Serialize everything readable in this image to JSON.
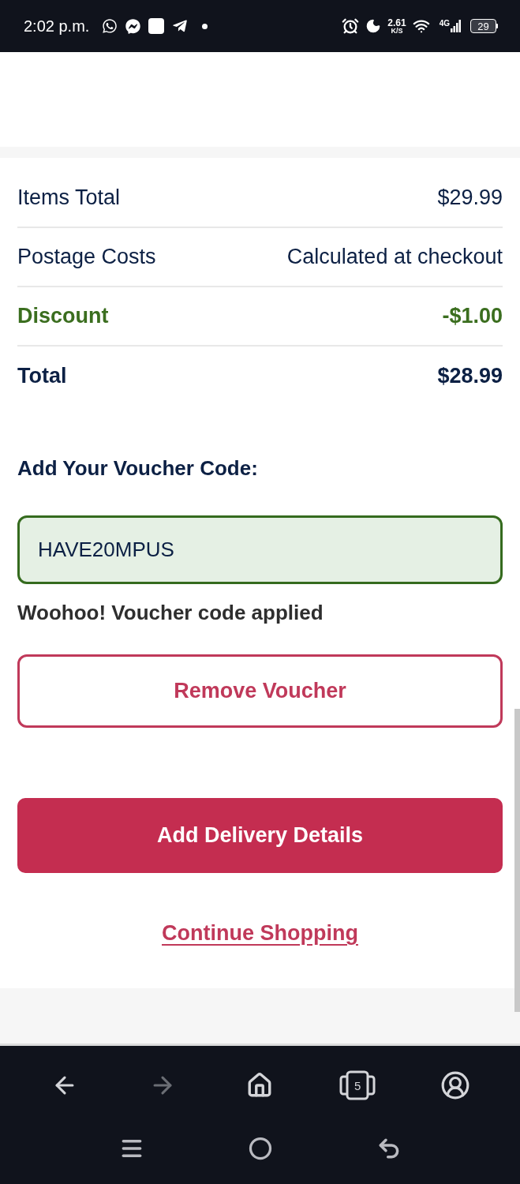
{
  "status_bar": {
    "time": "2:02 p.m.",
    "speed_value": "2.61",
    "speed_unit": "K/S",
    "network_type": "4G",
    "battery": "29"
  },
  "summary": {
    "rows": [
      {
        "kind": "plain",
        "label": "Items Total",
        "value": "$29.99"
      },
      {
        "kind": "plain",
        "label": "Postage Costs",
        "value": "Calculated at checkout"
      },
      {
        "kind": "discount",
        "label": "Discount",
        "value": "-$1.00"
      },
      {
        "kind": "total",
        "label": "Total",
        "value": "$28.99"
      }
    ]
  },
  "voucher": {
    "heading": "Add Your Voucher Code:",
    "value": "HAVE20MPUS",
    "valid": true,
    "message": "Woohoo! Voucher code applied",
    "remove_button": "Remove Voucher"
  },
  "actions": {
    "primary_button": "Add Delivery Details",
    "link": "Continue Shopping"
  },
  "browser_toolbar": {
    "items": [
      {
        "kind": "back",
        "disabled": false
      },
      {
        "kind": "forward",
        "disabled": true
      },
      {
        "kind": "home",
        "disabled": false
      },
      {
        "kind": "tabs",
        "count": "5",
        "disabled": false
      },
      {
        "kind": "account",
        "disabled": false
      }
    ]
  },
  "system_nav": {
    "items": [
      {
        "kind": "recents"
      },
      {
        "kind": "home"
      },
      {
        "kind": "back"
      }
    ]
  }
}
